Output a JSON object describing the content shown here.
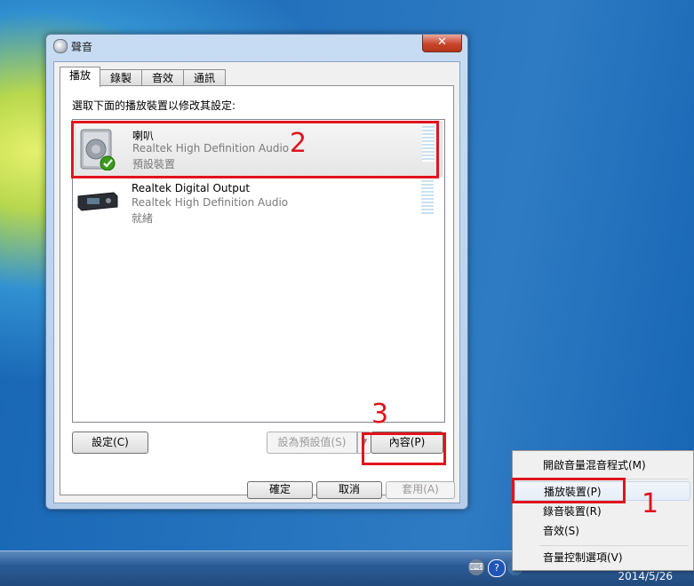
{
  "window": {
    "title": "聲音",
    "close_label": "✕",
    "tabs": [
      {
        "label": "播放"
      },
      {
        "label": "錄製"
      },
      {
        "label": "音效"
      },
      {
        "label": "通訊"
      }
    ],
    "instruction": "選取下面的播放裝置以修改其設定:",
    "devices": [
      {
        "name": "喇叭",
        "description": "Realtek High Definition Audio",
        "status": "預設裝置",
        "icon": "speaker-icon"
      },
      {
        "name": "Realtek Digital Output",
        "description": "Realtek High Definition Audio",
        "status": "就緒",
        "icon": "spdif-output-icon"
      }
    ],
    "buttons": {
      "configure": "設定(C)",
      "set_default": "設為預設值(S)",
      "properties": "內容(P)",
      "ok": "確定",
      "cancel": "取消",
      "apply": "套用(A)"
    }
  },
  "context_menu": {
    "items": [
      {
        "label": "開啟音量混音程式(M)"
      },
      {
        "label": "播放裝置(P)"
      },
      {
        "label": "錄音裝置(R)"
      },
      {
        "label": "音效(S)"
      },
      {
        "label": "音量控制選項(V)"
      }
    ]
  },
  "annotations": {
    "step1": "1",
    "step2": "2",
    "step3": "3",
    "highlight_color": "#e0141e"
  },
  "taskbar": {
    "date": "2014/5/26"
  }
}
